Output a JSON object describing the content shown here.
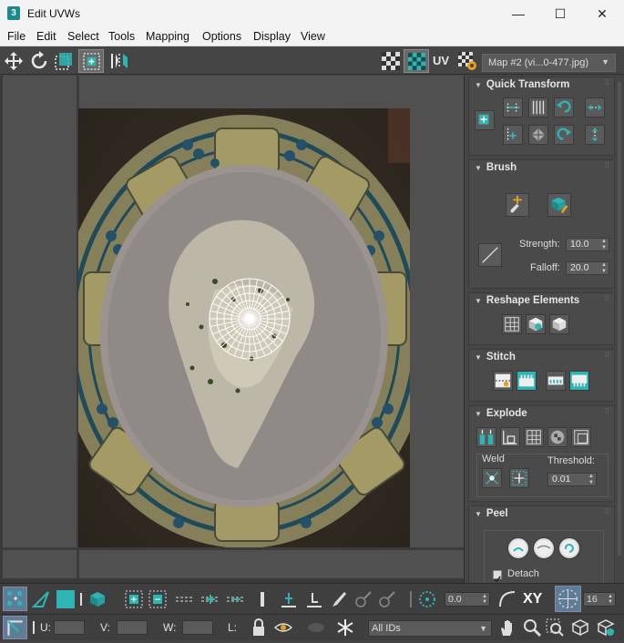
{
  "window": {
    "title": "Edit UVWs",
    "app_icon": "3",
    "minimize": "—",
    "maximize": "☐",
    "close": "✕"
  },
  "menu": [
    "File",
    "Edit",
    "Select",
    "Tools",
    "Mapping",
    "Options",
    "Display",
    "View"
  ],
  "toolbar": {
    "uv_label": "UV",
    "map_select": "Map #2 (vi...0-477.jpg)"
  },
  "panel": {
    "quick_transform": {
      "title": "Quick Transform"
    },
    "brush": {
      "title": "Brush",
      "strength_label": "Strength:",
      "strength_value": "10.0",
      "falloff_label": "Falloff:",
      "falloff_value": "20.0"
    },
    "reshape": {
      "title": "Reshape Elements"
    },
    "stitch": {
      "title": "Stitch"
    },
    "explode": {
      "title": "Explode",
      "weld_label": "Weld",
      "threshold_label": "Threshold:",
      "threshold_value": "0.01"
    },
    "peel": {
      "title": "Peel",
      "detach_label": "Detach",
      "detach_checked": true
    }
  },
  "bottom": {
    "spin_value": "0.0",
    "xy_label": "XY",
    "grid_value": "16",
    "u_label": "U:",
    "v_label": "V:",
    "w_label": "W:",
    "l_label": "L:",
    "ids_select": "All IDs"
  },
  "colors": {
    "accent": "#2fb4b4",
    "panel_bg": "#454545",
    "viewport_bg": "#505050"
  }
}
